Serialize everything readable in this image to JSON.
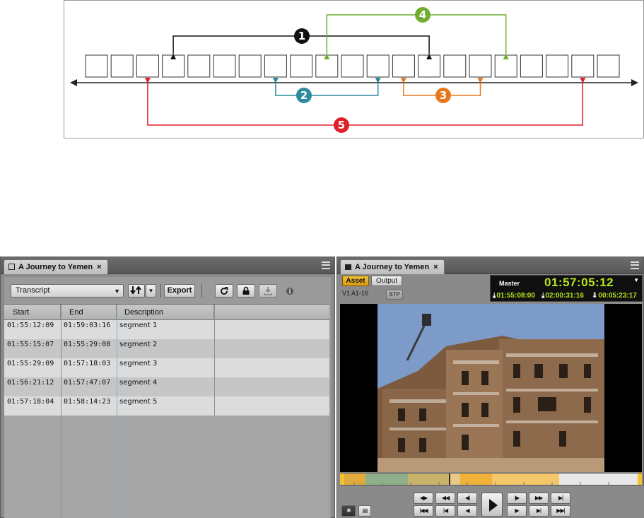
{
  "diagram": {
    "badges": [
      {
        "label": "1",
        "color": "#111111"
      },
      {
        "label": "2",
        "color": "#2e8a9e"
      },
      {
        "label": "3",
        "color": "#e8781e"
      },
      {
        "label": "4",
        "color": "#6fae2f"
      },
      {
        "label": "5",
        "color": "#e0202a"
      }
    ],
    "colors": {
      "axis": "#222222",
      "frame": "#333333"
    }
  },
  "left_panel": {
    "tab_title": "A Journey to Yemen",
    "tab_close": "×",
    "view_select": "Transcript",
    "export_label": "Export",
    "columns": [
      "Start",
      "End",
      "Description"
    ],
    "rows": [
      {
        "start": "01:55:12:09",
        "end": "01:59:03:16",
        "description": "segment 1"
      },
      {
        "start": "01:55:15:07",
        "end": "01:55:29:08",
        "description": "segment 2"
      },
      {
        "start": "01:55:29:09",
        "end": "01:57:18:03",
        "description": "segment 3"
      },
      {
        "start": "01:56:21:12",
        "end": "01:57:47:07",
        "description": "segment 4"
      },
      {
        "start": "01:57:18:04",
        "end": "01:58:14:23",
        "description": "segment 5"
      }
    ]
  },
  "right_panel": {
    "tab_title": "A Journey to Yemen",
    "tab_close": "×",
    "asset_label": "Asset",
    "output_label": "Output",
    "track_label": "V1 A1-16",
    "stp_label": "STP",
    "timecode": {
      "label": "Master",
      "main": "01:57:05:12",
      "mark_in": "01:55:08:00",
      "mark_out": "02:00:31:16",
      "duration": "00:05:23:17"
    }
  }
}
